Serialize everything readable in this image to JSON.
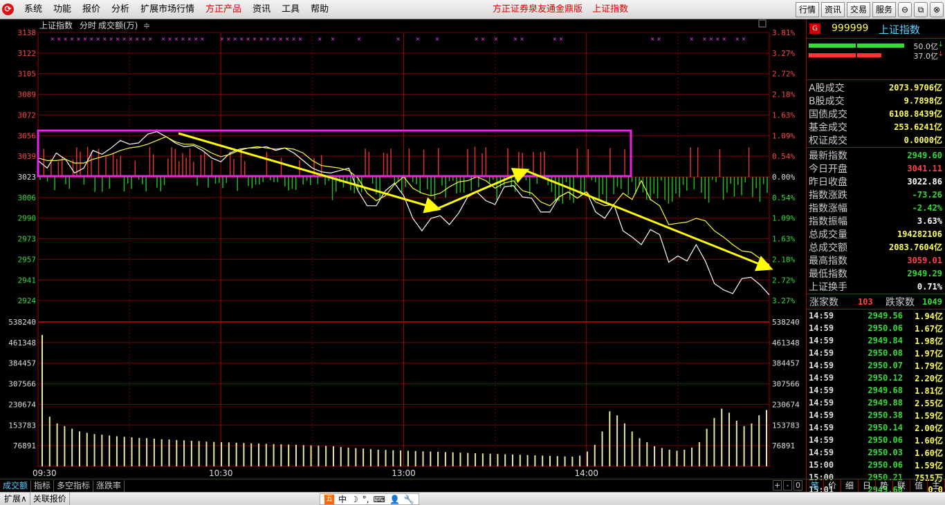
{
  "menubar": {
    "items": [
      "系统",
      "功能",
      "报价",
      "分析",
      "扩展市场行情",
      "方正产品",
      "资讯",
      "工具",
      "帮助"
    ],
    "caption": "方正证券泉友通金鼎版",
    "caption_index": "上证指数",
    "right_buttons": [
      "行情",
      "资讯",
      "交易",
      "服务"
    ]
  },
  "chart_header": {
    "name": "上证指数",
    "mode": "分时",
    "indicator": "成交额(万)",
    "toggle": "≑"
  },
  "chart_data": [
    {
      "type": "line",
      "title": "上证指数 分时",
      "prev_close": 3022.86,
      "ylim": [
        2908,
        3138
      ],
      "y_ticks_left": [
        "3138",
        "3122",
        "3105",
        "3089",
        "3072",
        "3056",
        "3039",
        "3023",
        "3006",
        "2990",
        "2973",
        "2957",
        "2941",
        "2924"
      ],
      "y_ticks_right": [
        "3.81%",
        "3.27%",
        "2.72%",
        "2.18%",
        "1.63%",
        "1.09%",
        "0.54%",
        "0.00%",
        "0.54%",
        "1.09%",
        "1.63%",
        "2.18%",
        "2.72%",
        "3.27%"
      ],
      "x_ticks": [
        "09:30",
        "10:30",
        "13:00",
        "14:00"
      ],
      "series": [
        {
          "name": "指数",
          "values": [
            3036,
            3030,
            3042,
            3037,
            3026,
            3030,
            3044,
            3041,
            3046,
            3052,
            3049,
            3050,
            3057,
            3059,
            3055,
            3050,
            3047,
            3048,
            3044,
            3038,
            3035,
            3042,
            3045,
            3046,
            3046,
            3047,
            3044,
            3046,
            3042,
            3036,
            3030,
            3027,
            3026,
            3028,
            3030,
            3012,
            3000,
            3000,
            3012,
            3018,
            3008,
            2990,
            2980,
            2990,
            2992,
            2985,
            2994,
            3007,
            3011,
            3004,
            3001,
            3015,
            3016,
            3007,
            3006,
            2995,
            2995,
            3007,
            3011,
            3006,
            3011,
            2995,
            2990,
            3001,
            2980,
            2975,
            2969,
            2981,
            2977,
            2955,
            2960,
            2956,
            2969,
            2956,
            2938,
            2933,
            2930,
            2942,
            2943,
            2937,
            2929
          ]
        },
        {
          "name": "均价",
          "values": [
            3038,
            3036,
            3036,
            3037,
            3034,
            3034,
            3037,
            3039,
            3041,
            3044,
            3046,
            3047,
            3049,
            3052,
            3055,
            3051,
            3049,
            3049,
            3046,
            3042,
            3039,
            3041,
            3044,
            3046,
            3047,
            3046,
            3045,
            3046,
            3045,
            3042,
            3036,
            3032,
            3031,
            3030,
            3028,
            3022,
            3010,
            3004,
            3008,
            3017,
            3023,
            3014,
            3010,
            3008,
            3010,
            3015,
            3019,
            3020,
            3023,
            3020,
            3014,
            3018,
            3020,
            3012,
            3010,
            3003,
            3000,
            3007,
            3011,
            3006,
            3011,
            3003,
            3000,
            3001,
            3010,
            3005,
            3020,
            3005,
            3000,
            2985,
            2986,
            2987,
            2990,
            2988,
            2980,
            2975,
            2969,
            2964,
            2963,
            2958,
            2953
          ]
        }
      ],
      "annotations": [
        "trend-arrows",
        "consolidation-box"
      ]
    },
    {
      "type": "bar",
      "title": "成交额",
      "ylim": [
        0,
        538240
      ],
      "y_ticks": [
        "538240",
        "461348",
        "384457",
        "307566",
        "230674",
        "153783",
        "76891"
      ],
      "series": [
        {
          "name": "成交额",
          "values": [
            490000,
            185000,
            160000,
            150000,
            140000,
            130000,
            125000,
            120000,
            118000,
            115000,
            112000,
            110000,
            108000,
            106000,
            105000,
            103000,
            101000,
            100000,
            98000,
            97000,
            95000,
            94000,
            92000,
            91000,
            90000,
            89000,
            88000,
            87000,
            86000,
            85000,
            84000,
            83000,
            82000,
            81000,
            80000,
            79000,
            78000,
            77000,
            76000,
            75000,
            72000,
            70000,
            68000,
            66000,
            64000,
            62000,
            61000,
            60000,
            59000,
            58000,
            57000,
            56000,
            55000,
            54000,
            53000,
            52000,
            51000,
            50000,
            49000,
            48000,
            47000,
            46000,
            45000,
            44000,
            43000,
            42000,
            41000,
            40000,
            39000,
            38000,
            37000,
            36000,
            40000,
            55000,
            80000,
            130000,
            205000,
            190000,
            160000,
            130000,
            105000,
            90000,
            75000,
            68000,
            62000,
            58000,
            62000,
            70000,
            90000,
            140000,
            180000,
            215000,
            200000,
            170000,
            150000,
            160000,
            190000,
            210000
          ]
        }
      ]
    }
  ],
  "side": {
    "badge": "G",
    "code": "999999",
    "name": "上证指数",
    "bar_up_label": "50.0亿",
    "bar_down_label": "37.0亿",
    "stats": [
      {
        "k": "A股成交",
        "v": "2073.9706亿",
        "c": "#ffff55"
      },
      {
        "k": "B股成交",
        "v": "9.7898亿",
        "c": "#ffff55"
      },
      {
        "k": "国债成交",
        "v": "6108.8439亿",
        "c": "#ffff55"
      },
      {
        "k": "基金成交",
        "v": "253.6241亿",
        "c": "#ffff55"
      },
      {
        "k": "权证成交",
        "v": "0.0000亿",
        "c": "#ffff55"
      }
    ],
    "quote": [
      {
        "k": "最新指数",
        "v": "2949.60",
        "c": "#33dd33"
      },
      {
        "k": "今日开盘",
        "v": "3041.11",
        "c": "#ff4444"
      },
      {
        "k": "昨日收盘",
        "v": "3022.86",
        "c": "#ffffff"
      },
      {
        "k": "指数涨跌",
        "v": "-73.26",
        "c": "#33dd33"
      },
      {
        "k": "指数涨幅",
        "v": "-2.42%",
        "c": "#33dd33"
      },
      {
        "k": "指数振幅",
        "v": "3.63%",
        "c": "#ffffff"
      },
      {
        "k": "总成交量",
        "v": "194282106",
        "c": "#ffff55"
      },
      {
        "k": "总成交额",
        "v": "2083.7604亿",
        "c": "#ffff55"
      },
      {
        "k": "最高指数",
        "v": "3059.01",
        "c": "#ff4444"
      },
      {
        "k": "最低指数",
        "v": "2949.29",
        "c": "#33dd33"
      },
      {
        "k": "上证换手",
        "v": "0.71%",
        "c": "#ffffff"
      }
    ],
    "up_label": "涨家数",
    "up_count": "103",
    "down_label": "跌家数",
    "down_count": "1049",
    "ticks": [
      {
        "t": "14:59",
        "p": "2949.56",
        "a": "1.94亿"
      },
      {
        "t": "14:59",
        "p": "2950.06",
        "a": "1.67亿"
      },
      {
        "t": "14:59",
        "p": "2949.84",
        "a": "1.98亿"
      },
      {
        "t": "14:59",
        "p": "2950.08",
        "a": "1.97亿"
      },
      {
        "t": "14:59",
        "p": "2950.07",
        "a": "1.79亿"
      },
      {
        "t": "14:59",
        "p": "2950.12",
        "a": "2.20亿"
      },
      {
        "t": "14:59",
        "p": "2949.68",
        "a": "1.81亿"
      },
      {
        "t": "14:59",
        "p": "2949.88",
        "a": "2.55亿"
      },
      {
        "t": "14:59",
        "p": "2950.38",
        "a": "1.59亿"
      },
      {
        "t": "14:59",
        "p": "2950.14",
        "a": "2.00亿"
      },
      {
        "t": "14:59",
        "p": "2950.06",
        "a": "1.60亿"
      },
      {
        "t": "14:59",
        "p": "2950.03",
        "a": "1.60亿"
      },
      {
        "t": "15:00",
        "p": "2950.06",
        "a": "1.59亿"
      },
      {
        "t": "15:00",
        "p": "2950.21",
        "a": "7515万"
      },
      {
        "t": "15:01",
        "p": "2949.60",
        "a": "0.0"
      }
    ],
    "tabs": [
      "笔",
      "价",
      "细",
      "日",
      "势",
      "联",
      "值",
      "主"
    ]
  },
  "bottom_tabs": [
    "成交额",
    "指标",
    "多空指标",
    "涨跌率"
  ],
  "bottom_ctl": [
    "+",
    "-",
    "0"
  ],
  "status": {
    "items": [
      "扩展∧",
      "关联报价"
    ],
    "ime": [
      "五",
      "中",
      "☽",
      "°,",
      "⌨",
      "👤",
      "🔧"
    ]
  }
}
